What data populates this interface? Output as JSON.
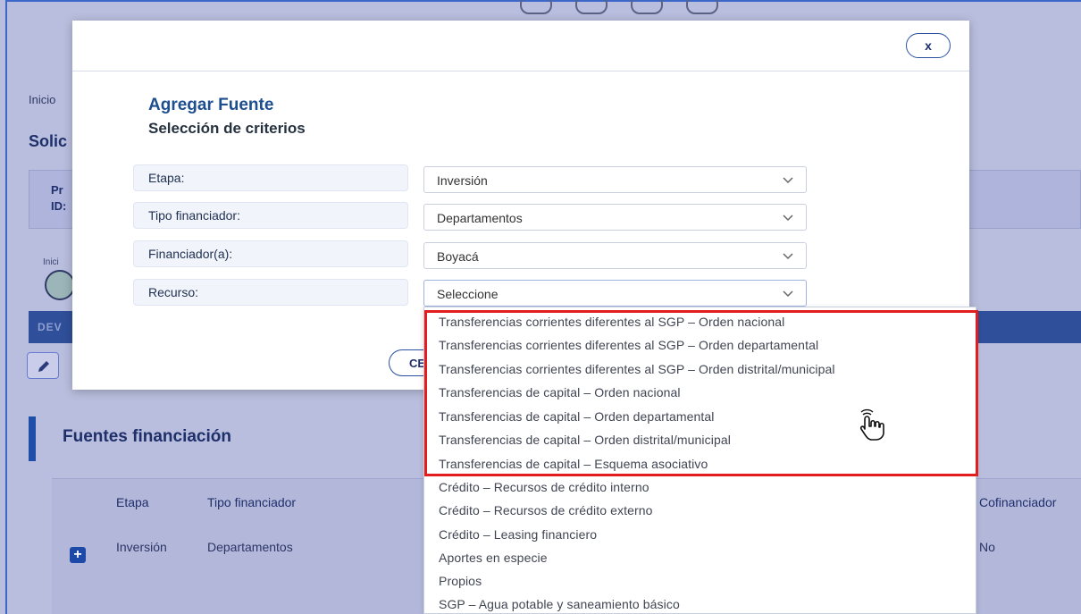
{
  "background": {
    "breadcrumb": "Inicio",
    "page_title": "Solic",
    "info_line1": "Pr",
    "info_line2": "ID:",
    "step_label": "Inici",
    "action_bar_label": "DEV",
    "section_title": "Fuentes financiación",
    "table": {
      "headers": [
        "Etapa",
        "Tipo financiador",
        "Cofinanciador"
      ],
      "row": [
        "Inversión",
        "Departamentos",
        "No"
      ]
    }
  },
  "modal": {
    "close_label": "x",
    "title": "Agregar Fuente",
    "subtitle": "Selección de criterios",
    "criteria": [
      {
        "label": "Etapa:",
        "value": "Inversión"
      },
      {
        "label": "Tipo financiador:",
        "value": "Departamentos"
      },
      {
        "label": "Financiador(a):",
        "value": "Boyacá"
      },
      {
        "label": "Recurso:",
        "value": "Seleccione"
      }
    ],
    "cancel_label": "CE"
  },
  "dropdown": {
    "options": [
      "Transferencias corrientes diferentes al SGP – Orden nacional",
      "Transferencias corrientes diferentes al SGP – Orden departamental",
      "Transferencias corrientes diferentes al SGP – Orden distrital/municipal",
      "Transferencias de capital – Orden nacional",
      "Transferencias de capital – Orden departamental",
      "Transferencias de capital – Orden distrital/municipal",
      "Transferencias de capital – Esquema asociativo",
      "Crédito – Recursos de crédito interno",
      "Crédito – Recursos de crédito externo",
      "Crédito – Leasing financiero",
      "Aportes en especie",
      "Propios",
      "SGP – Agua potable y saneamiento básico"
    ]
  },
  "colors": {
    "highlight": "#e11d1d",
    "accent": "#1d4e8f",
    "overlay": "#b9bede"
  }
}
